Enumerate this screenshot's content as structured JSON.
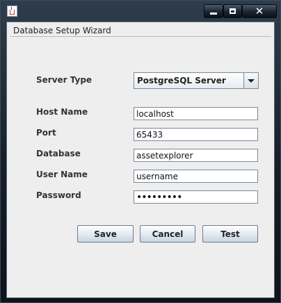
{
  "window": {
    "title": "",
    "buttons": {
      "minimize": "minimize",
      "maximize": "maximize",
      "close": "✕"
    }
  },
  "form": {
    "group_title": "Database Setup Wizard",
    "server_type": {
      "label": "Server Type",
      "value": "PostgreSQL Server"
    },
    "host_name": {
      "label": "Host Name",
      "value": "localhost"
    },
    "port": {
      "label": "Port",
      "value": "65433"
    },
    "database": {
      "label": "Database",
      "value": "assetexplorer"
    },
    "user_name": {
      "label": "User Name",
      "value": "username"
    },
    "password": {
      "label": "Password",
      "value": "•••••••••"
    }
  },
  "actions": {
    "save": "Save",
    "cancel": "Cancel",
    "test": "Test"
  }
}
